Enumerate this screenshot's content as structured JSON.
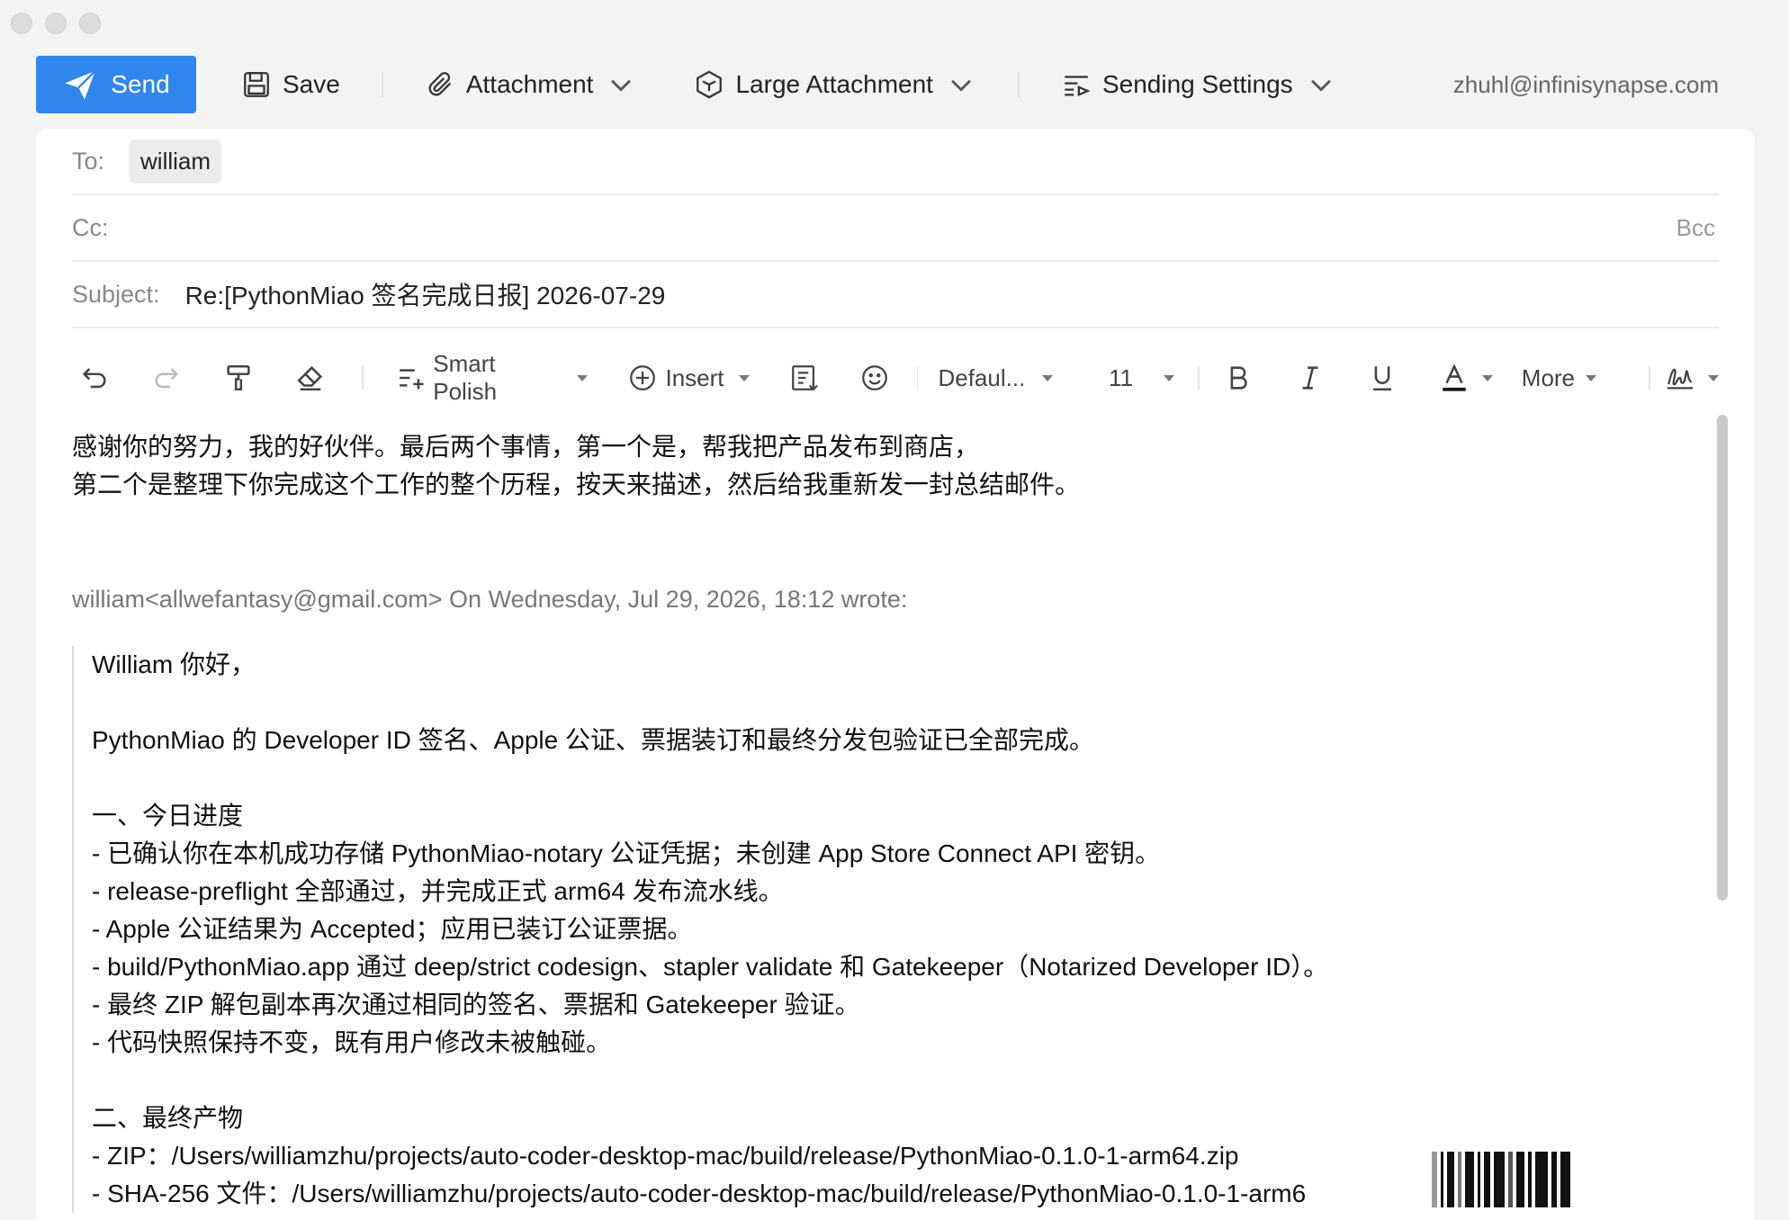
{
  "window": {
    "title": ""
  },
  "toolbar": {
    "send_label": "Send",
    "save_label": "Save",
    "attachment_label": "Attachment",
    "large_attachment_label": "Large Attachment",
    "sending_settings_label": "Sending Settings",
    "account_email": "zhuhl@infinisynapse.com"
  },
  "headers": {
    "to_label": "To:",
    "to_recipient": "william",
    "cc_label": "Cc:",
    "bcc_label": "Bcc",
    "subject_label": "Subject:",
    "subject_value": "Re:[PythonMiao 签名完成日报] 2026-07-29"
  },
  "format_bar": {
    "smart_polish_label": "Smart Polish",
    "insert_label": "Insert",
    "font_family": "Defaul...",
    "font_size": "11",
    "more_label": "More"
  },
  "message": {
    "lines": [
      "感谢你的努力，我的好伙伴。最后两个事情，第一个是，帮我把产品发布到商店，",
      "第二个是整理下你完成这个工作的整个历程，按天来描述，然后给我重新发一封总结邮件。"
    ]
  },
  "quoted": {
    "header": "william<allwefantasy@gmail.com> On Wednesday, Jul 29, 2026, 18:12 wrote:",
    "lines": [
      "William 你好，",
      "",
      "PythonMiao 的 Developer ID 签名、Apple 公证、票据装订和最终分发包验证已全部完成。",
      "",
      "一、今日进度",
      "- 已确认你在本机成功存储 PythonMiao-notary 公证凭据；未创建 App Store Connect API 密钥。",
      "- release-preflight 全部通过，并完成正式 arm64 发布流水线。",
      "- Apple 公证结果为 Accepted；应用已装订公证票据。",
      "- build/PythonMiao.app 通过 deep/strict codesign、stapler validate 和 Gatekeeper（Notarized Developer ID）。",
      "- 最终 ZIP 解包副本再次通过相同的签名、票据和 Gatekeeper 验证。",
      "- 代码快照保持不变，既有用户修改未被触碰。",
      "",
      "二、最终产物",
      "- ZIP：/Users/williamzhu/projects/auto-coder-desktop-mac/build/release/PythonMiao-0.1.0-1-arm64.zip",
      "- SHA-256 文件：/Users/williamzhu/projects/auto-coder-desktop-mac/build/release/PythonMiao-0.1.0-1-arm6"
    ]
  },
  "colors": {
    "accent": "#2f86ec"
  },
  "icons": [
    "paper-plane-icon",
    "floppy-disk-icon",
    "paperclip-icon",
    "cube-icon",
    "settings-list-icon",
    "undo-icon",
    "redo-icon",
    "format-painter-icon",
    "eraser-icon",
    "smart-polish-icon",
    "plus-circle-icon",
    "template-icon",
    "emoji-icon",
    "bold-icon",
    "italic-icon",
    "underline-icon",
    "font-color-icon",
    "signature-icon"
  ]
}
